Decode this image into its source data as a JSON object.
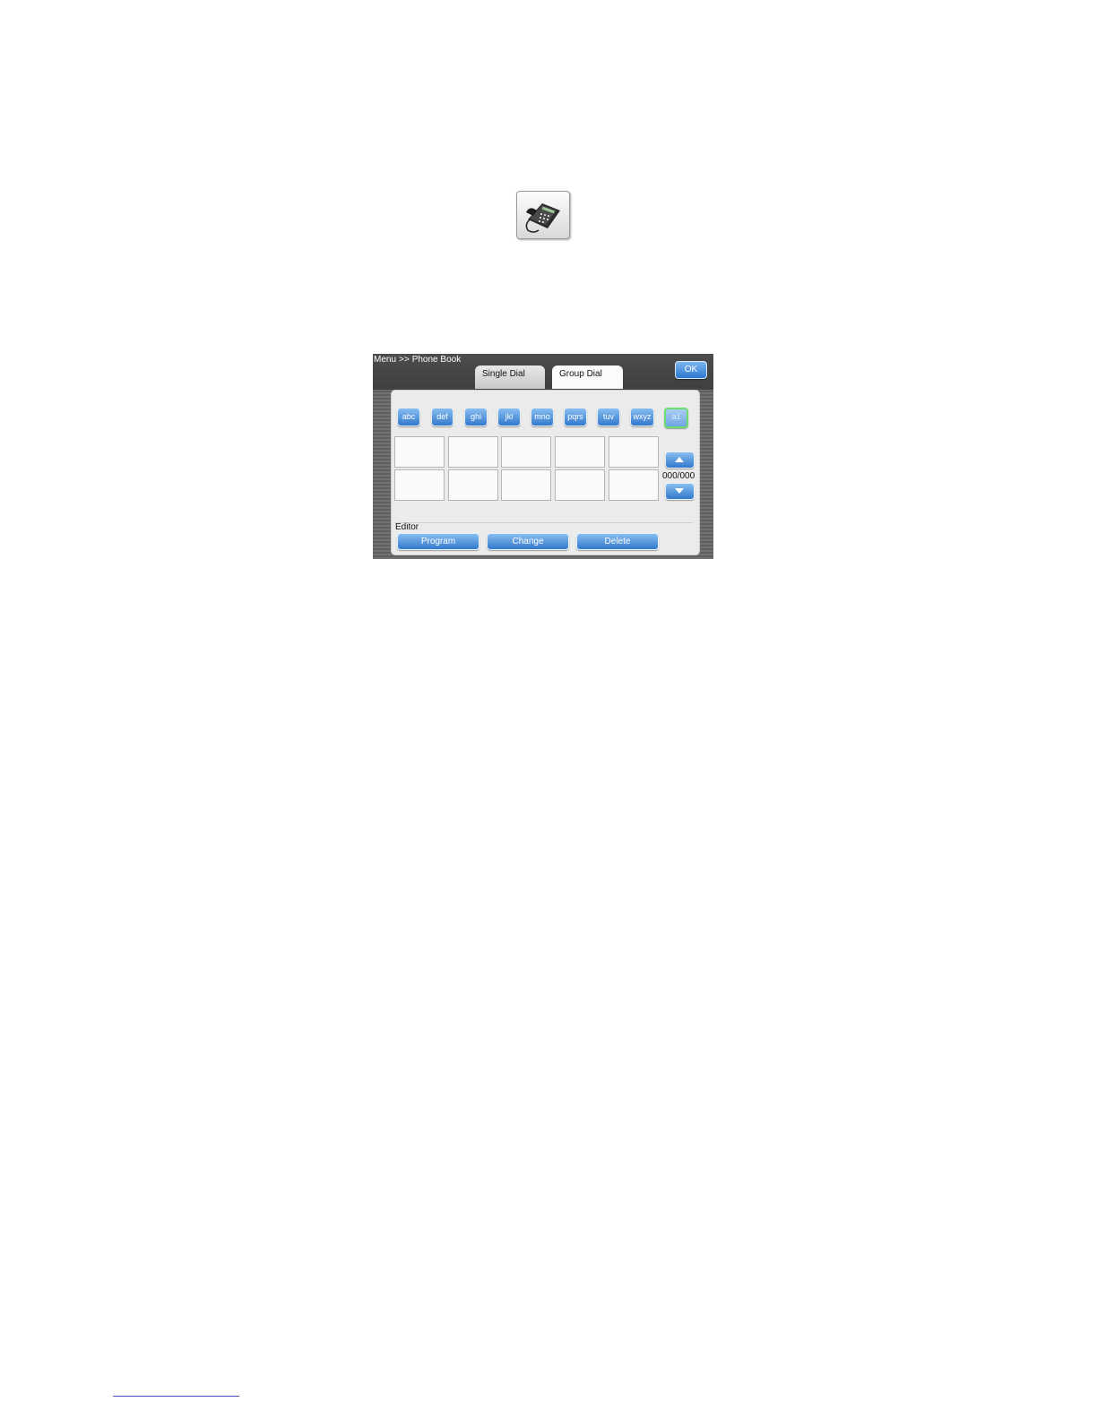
{
  "icons": {
    "phone": "desk-telephone-icon",
    "scroll_up": "triangle-up-icon",
    "scroll_down": "triangle-down-icon"
  },
  "header": {
    "breadcrumb_root": "Menu",
    "breadcrumb_sep": ">>",
    "breadcrumb_page": "Phone Book",
    "ok_label": "OK"
  },
  "tabs": [
    {
      "label": "Single Dial",
      "selected": false
    },
    {
      "label": "Group Dial",
      "selected": true
    }
  ],
  "letter_filters": [
    "abc",
    "def",
    "ghi",
    "jkl",
    "mno",
    "pqrs",
    "tuv",
    "wxyz",
    "a1"
  ],
  "list": {
    "counter": "000/000",
    "entries": [
      "",
      "",
      "",
      "",
      "",
      "",
      "",
      "",
      "",
      ""
    ]
  },
  "editor": {
    "label": "Editor",
    "buttons": [
      "Program",
      "Change",
      "Delete"
    ]
  },
  "colors": {
    "accent": "#3379cd",
    "selected_outline": "#6fdc6f",
    "bar": "#4d4d4d"
  }
}
